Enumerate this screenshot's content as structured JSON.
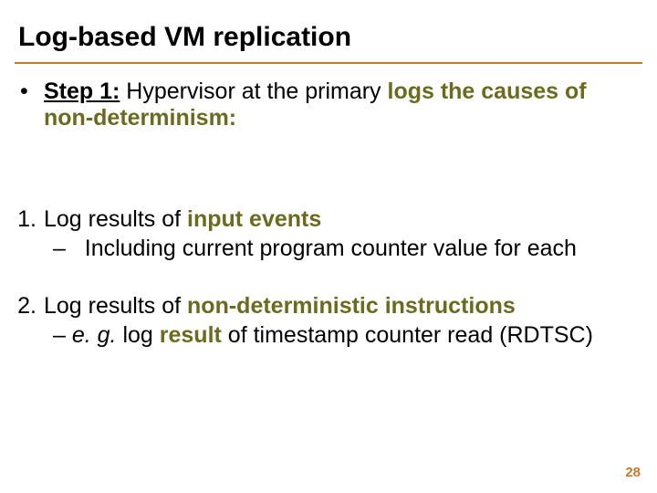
{
  "title": "Log-based VM replication",
  "step": {
    "bullet": "•",
    "lead": "Step 1:",
    "mid": " Hypervisor at the primary ",
    "accent": "logs the causes of non-determinism:"
  },
  "item1": {
    "num": "1.",
    "pre": "Log results of ",
    "strong": "input events",
    "sub_dash": "–",
    "sub_text": "Including current program counter value for each"
  },
  "item2": {
    "num": "2.",
    "pre": "Log results of ",
    "strong": "non-deterministic instructions",
    "sub_dash": "–",
    "sub_eg": " e. g. ",
    "sub_mid1": "log ",
    "sub_result": "result",
    "sub_tail": " of timestamp counter read (RDTSC)"
  },
  "page_number": "28"
}
